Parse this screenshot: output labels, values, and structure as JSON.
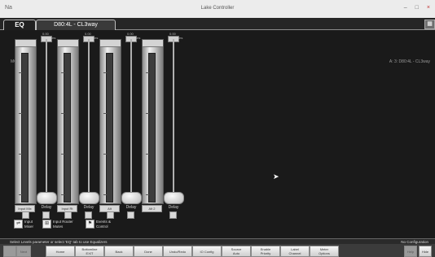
{
  "window": {
    "title": "Lake Controller",
    "app_icon": "Na",
    "controls": [
      "–",
      "□",
      "×"
    ]
  },
  "tabs": {
    "eq": "EQ",
    "device": "D80:4L - CL3way"
  },
  "module_label": "MODULE",
  "top_right": "A: 3: D80:4L - CL3way",
  "channels": [
    {
      "val": "0.00",
      "ms": "ms",
      "delay": "Delay",
      "btn": "Input Mix"
    },
    {
      "val": "0.00",
      "ms": "ms",
      "delay": "Delay",
      "btn": "Input Rt"
    },
    {
      "val": "0.00",
      "ms": "ms",
      "delay": "Delay",
      "btn": "Alt"
    },
    {
      "val": "0.00",
      "ms": "ms",
      "delay": "Delay",
      "btn": "Alt 2"
    },
    {
      "val": "0.00",
      "ms": "ms",
      "delay": "Delay",
      "btn": ""
    }
  ],
  "legend": {
    "mixer": "Input\nMixer",
    "router": "Input Router\nMutes",
    "events": "Events &\nControl"
  },
  "status": {
    "left": "Select Levels parameter or select 'EQ' tab to use Equalizers",
    "right": "No Configuration"
  },
  "bottom_buttons": [
    {
      "label": "",
      "dim": true
    },
    {
      "label": "Next",
      "dim": true
    },
    {
      "label": "Home",
      "dim": false
    },
    {
      "label": "Bottomline\nEXIT",
      "dim": false
    },
    {
      "label": "Back",
      "dim": false
    },
    {
      "label": "Done",
      "dim": false
    },
    {
      "label": "Undo/Redo",
      "dim": false
    },
    {
      "label": "IO Config",
      "dim": false
    },
    {
      "label": "Source\nAuto",
      "dim": false
    },
    {
      "label": "Enable\nPriority",
      "dim": false
    },
    {
      "label": "Label\nChannel",
      "dim": false
    },
    {
      "label": "Meter\nOptions",
      "dim": false
    },
    {
      "label": "Help",
      "dim": true
    },
    {
      "label": "Hide",
      "dim": false
    }
  ]
}
